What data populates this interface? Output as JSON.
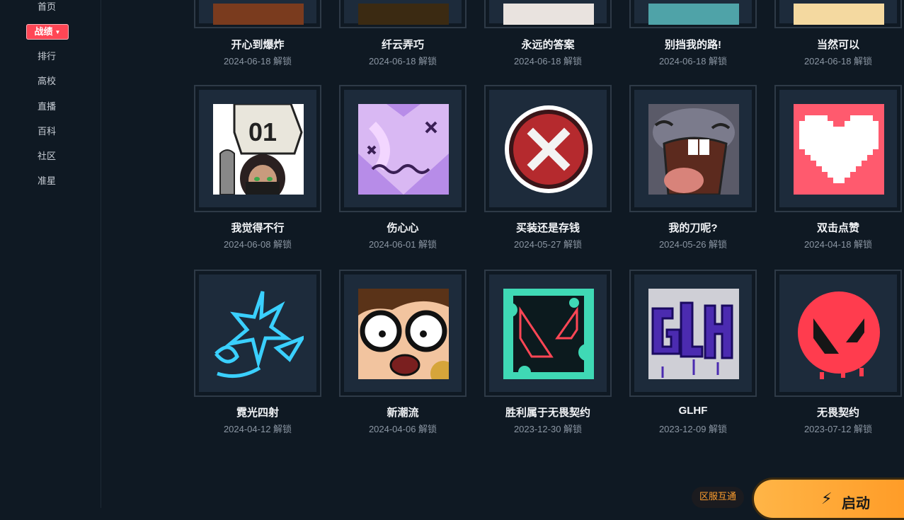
{
  "sidebar": {
    "items": [
      {
        "label": "首页"
      },
      {
        "label": "战绩"
      },
      {
        "label": "排行"
      },
      {
        "label": "高校"
      },
      {
        "label": "直播"
      },
      {
        "label": "百科"
      },
      {
        "label": "社区"
      },
      {
        "label": "准星"
      }
    ],
    "active_index": 1
  },
  "sprays": {
    "row_top": [
      {
        "name": "开心到爆炸",
        "date": "2024-06-18 解锁"
      },
      {
        "name": "纤云弄巧",
        "date": "2024-06-18 解锁"
      },
      {
        "name": "永远的答案",
        "date": "2024-06-18 解锁"
      },
      {
        "name": "别挡我的路!",
        "date": "2024-06-18 解锁"
      },
      {
        "name": "当然可以",
        "date": "2024-06-18 解锁"
      }
    ],
    "row_middle": [
      {
        "name": "我觉得不行",
        "date": "2024-06-08 解锁",
        "icon": "agent-01-sign-icon"
      },
      {
        "name": "伤心心",
        "date": "2024-06-01 解锁",
        "icon": "purple-broken-heart-icon"
      },
      {
        "name": "买装还是存钱",
        "date": "2024-05-27 解锁",
        "icon": "red-x-button-icon"
      },
      {
        "name": "我的刀呢?",
        "date": "2024-05-26 解锁",
        "icon": "crying-creature-icon"
      },
      {
        "name": "双击点赞",
        "date": "2024-04-18 解锁",
        "icon": "pixel-heart-icon"
      }
    ],
    "row_bottom": [
      {
        "name": "霓光四射",
        "date": "2024-04-12 解锁",
        "icon": "neon-stars-icon"
      },
      {
        "name": "新潮流",
        "date": "2024-04-06 解锁",
        "icon": "shocked-face-icon"
      },
      {
        "name": "胜利属于无畏契约",
        "date": "2023-12-30 解锁",
        "icon": "valorant-logo-splatter-icon"
      },
      {
        "name": "GLHF",
        "date": "2023-12-09 解锁",
        "icon": "glhf-graffiti-icon"
      },
      {
        "name": "无畏契约",
        "date": "2023-07-12 解锁",
        "icon": "valorant-red-circle-icon"
      }
    ]
  },
  "footer": {
    "region_label": "区服互通",
    "launch_label": "启动",
    "launch_icon": "lightning-icon"
  },
  "colors": {
    "background": "#0f1923",
    "accent": "#ff4655",
    "launch": "#ffa733"
  }
}
